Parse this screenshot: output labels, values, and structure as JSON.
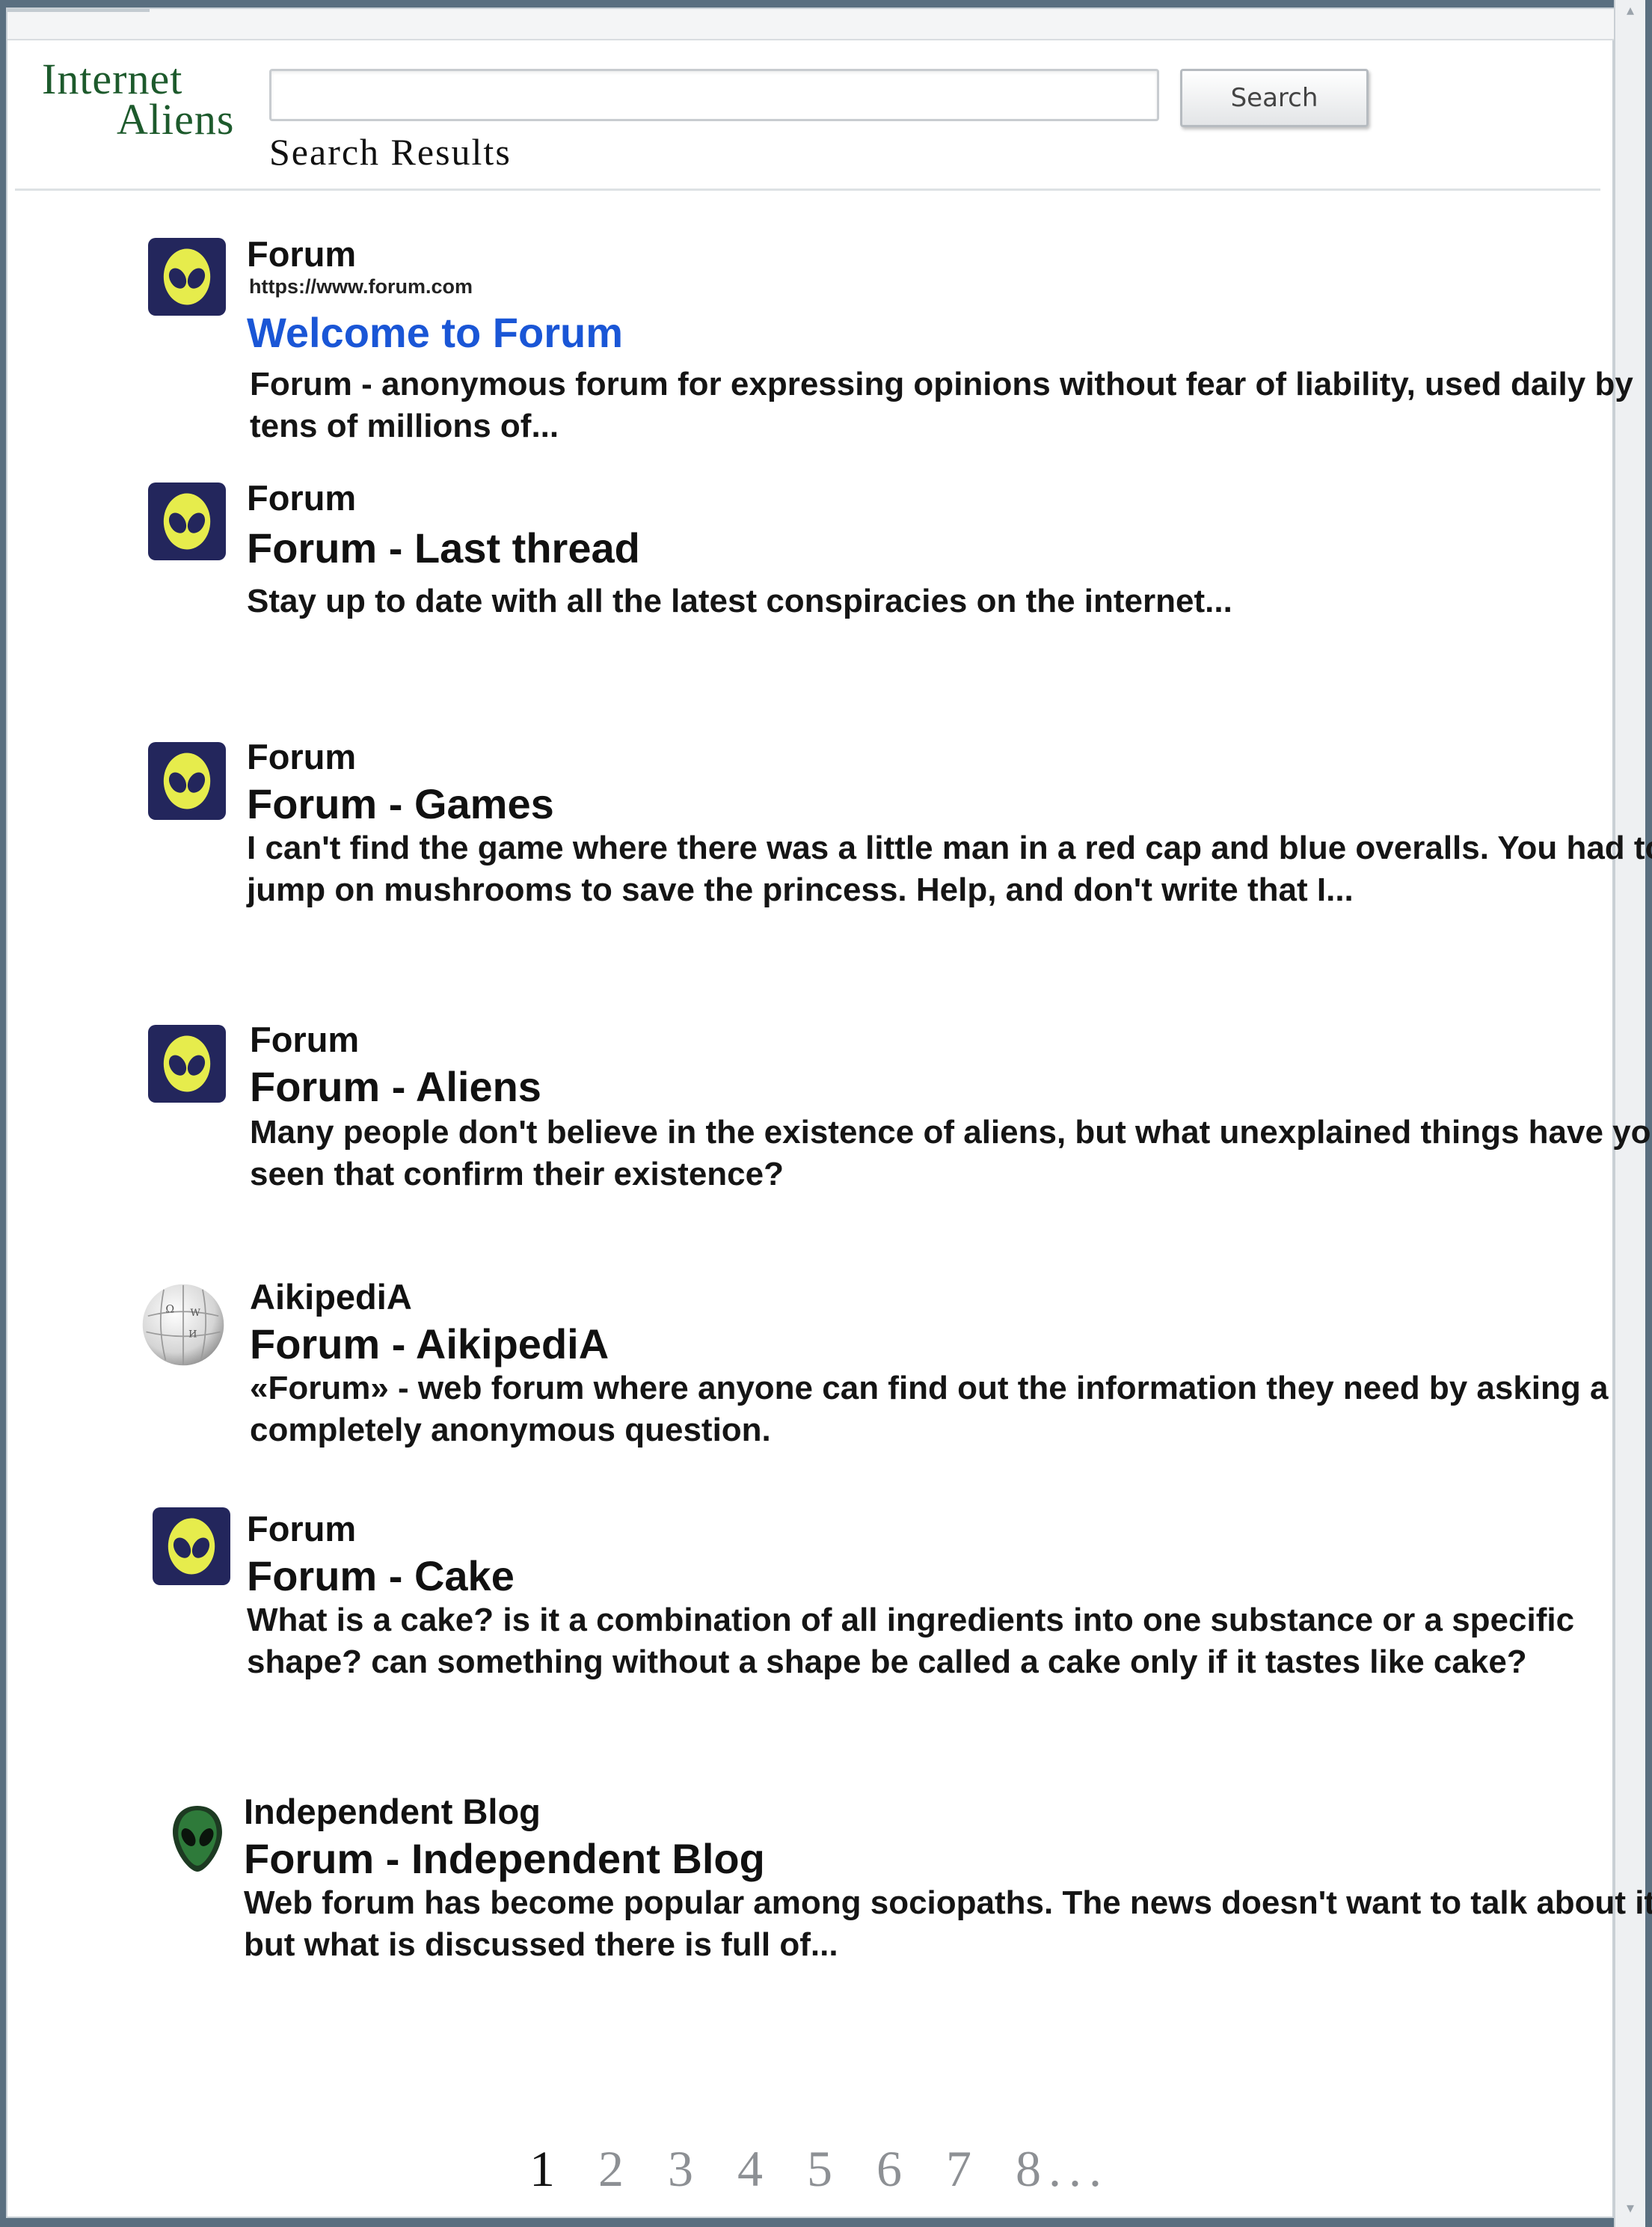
{
  "header": {
    "logo_line1": "Internet",
    "logo_line2": "Aliens",
    "search_value": "",
    "search_button": "Search",
    "results_heading": "Search Results"
  },
  "results": [
    {
      "icon": "alien-icon",
      "site": "Forum",
      "url": "https://www.forum.com",
      "title": "Welcome to Forum",
      "snippet": "Forum - anonymous forum for expressing opinions without fear of liability, used daily by tens of millions of..."
    },
    {
      "icon": "alien-icon",
      "site": "Forum",
      "title": "Forum - Last thread",
      "snippet": "Stay up to date with all the latest conspiracies on the internet..."
    },
    {
      "icon": "alien-icon",
      "site": "Forum",
      "title": "Forum - Games",
      "snippet": "I can't find the game where there was a little man in a red cap and blue overalls. You had to jump on mushrooms to save the princess. Help, and don't write that I..."
    },
    {
      "icon": "alien-icon",
      "site": "Forum",
      "title": "Forum - Aliens",
      "snippet": "Many people don't believe in the existence of aliens, but what unexplained things have you seen that confirm their existence?"
    },
    {
      "icon": "puzzle-globe-icon",
      "site": "AikipediA",
      "title": "Forum - AikipediA",
      "snippet": "«Forum» - web forum where anyone can find out the information they need by asking a completely anonymous question."
    },
    {
      "icon": "alien-icon",
      "site": "Forum",
      "title": "Forum - Cake",
      "snippet": "What is a cake? is it a combination of all ingredients into one substance or a specific shape? can something without a shape be called a cake only if it tastes like cake?"
    },
    {
      "icon": "dark-alien-icon",
      "site": "Independent Blog",
      "title": "Forum - Independent Blog",
      "snippet": "Web forum has become popular among sociopaths. The news doesn't want to talk about it, but what is discussed there is full of..."
    }
  ],
  "pagination": {
    "current": "1",
    "pages": [
      "2",
      "3",
      "4",
      "5",
      "6",
      "7",
      "8..."
    ]
  },
  "colors": {
    "logo": "#1d5a2c",
    "link": "#1a56d6",
    "favicon_bg": "#23265c",
    "alien_face": "#e6ec4c"
  }
}
